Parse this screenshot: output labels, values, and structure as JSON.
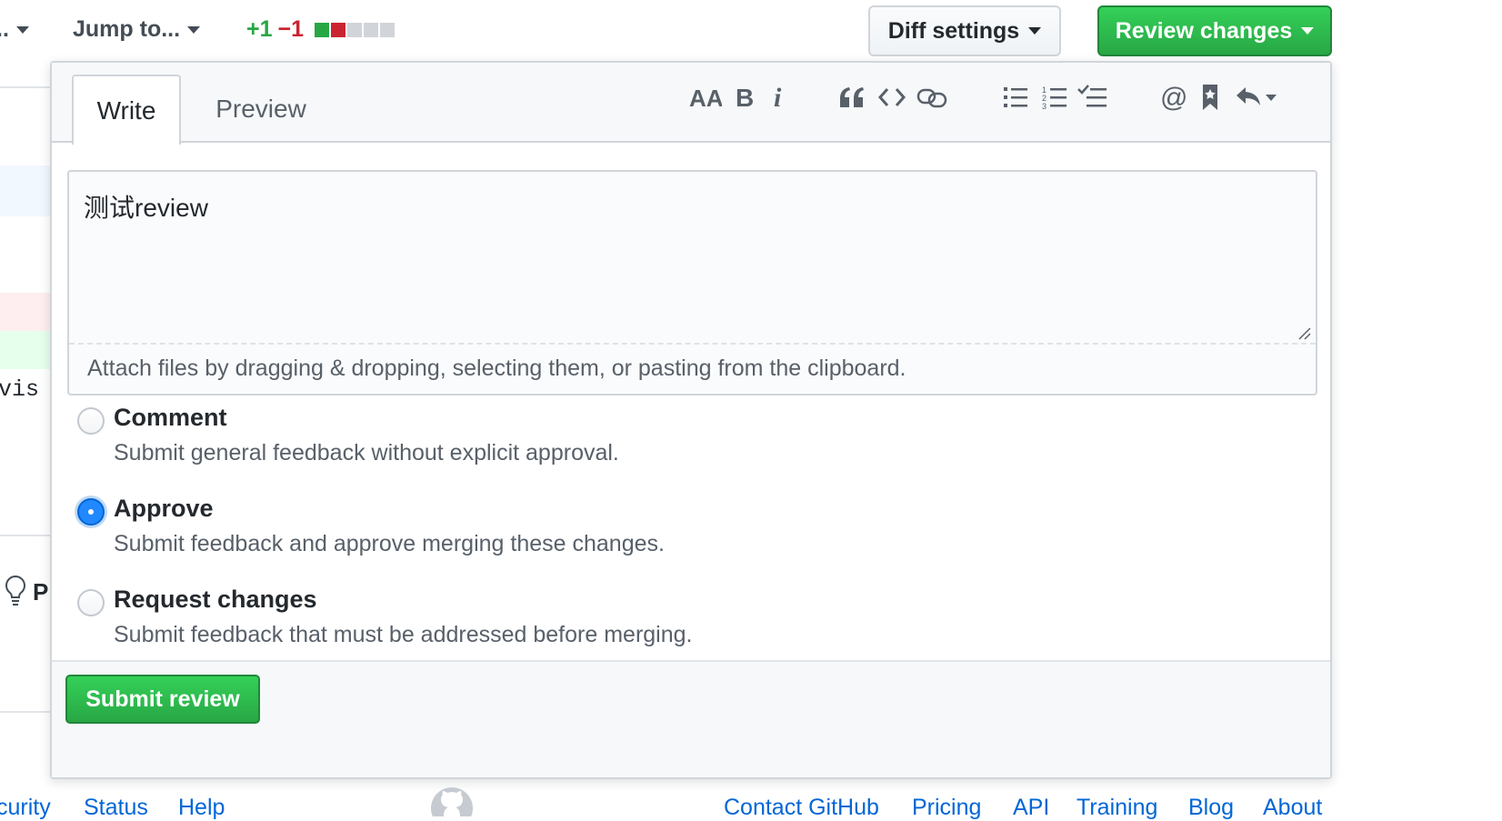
{
  "toolbar": {
    "truncated_dropdown": "..",
    "jump_to": "Jump to...",
    "additions": "+1",
    "deletions": "−1",
    "diffstat": [
      "#28a745",
      "#cb2431",
      "#d1d5da",
      "#d1d5da",
      "#d1d5da"
    ],
    "diff_settings": "Diff settings",
    "review_changes": "Review changes"
  },
  "background": {
    "code_fragment": "vis",
    "tip_letter": "P"
  },
  "review": {
    "tabs": {
      "write": "Write",
      "preview": "Preview"
    },
    "toolbar_icons": [
      "text-size-icon",
      "bold-icon",
      "italic-icon",
      "quote-icon",
      "code-icon",
      "link-icon",
      "unordered-list-icon",
      "ordered-list-icon",
      "task-list-icon",
      "mention-icon",
      "saved-reply-icon",
      "reply-icon"
    ],
    "comment_text": "测试review",
    "attach_hint": "Attach files by dragging & dropping, selecting them, or pasting from the clipboard.",
    "options": [
      {
        "title": "Comment",
        "desc": "Submit general feedback without explicit approval.",
        "checked": false
      },
      {
        "title": "Approve",
        "desc": "Submit feedback and approve merging these changes.",
        "checked": true
      },
      {
        "title": "Request changes",
        "desc": "Submit feedback that must be addressed before merging.",
        "checked": false
      }
    ],
    "submit": "Submit review"
  },
  "footer": {
    "links": [
      "curity",
      "Status",
      "Help",
      "Contact GitHub",
      "Pricing",
      "API",
      "Training",
      "Blog",
      "About"
    ]
  },
  "colors": {
    "green": "#28a745",
    "red": "#cb2431",
    "blue_link": "#0366d6"
  }
}
